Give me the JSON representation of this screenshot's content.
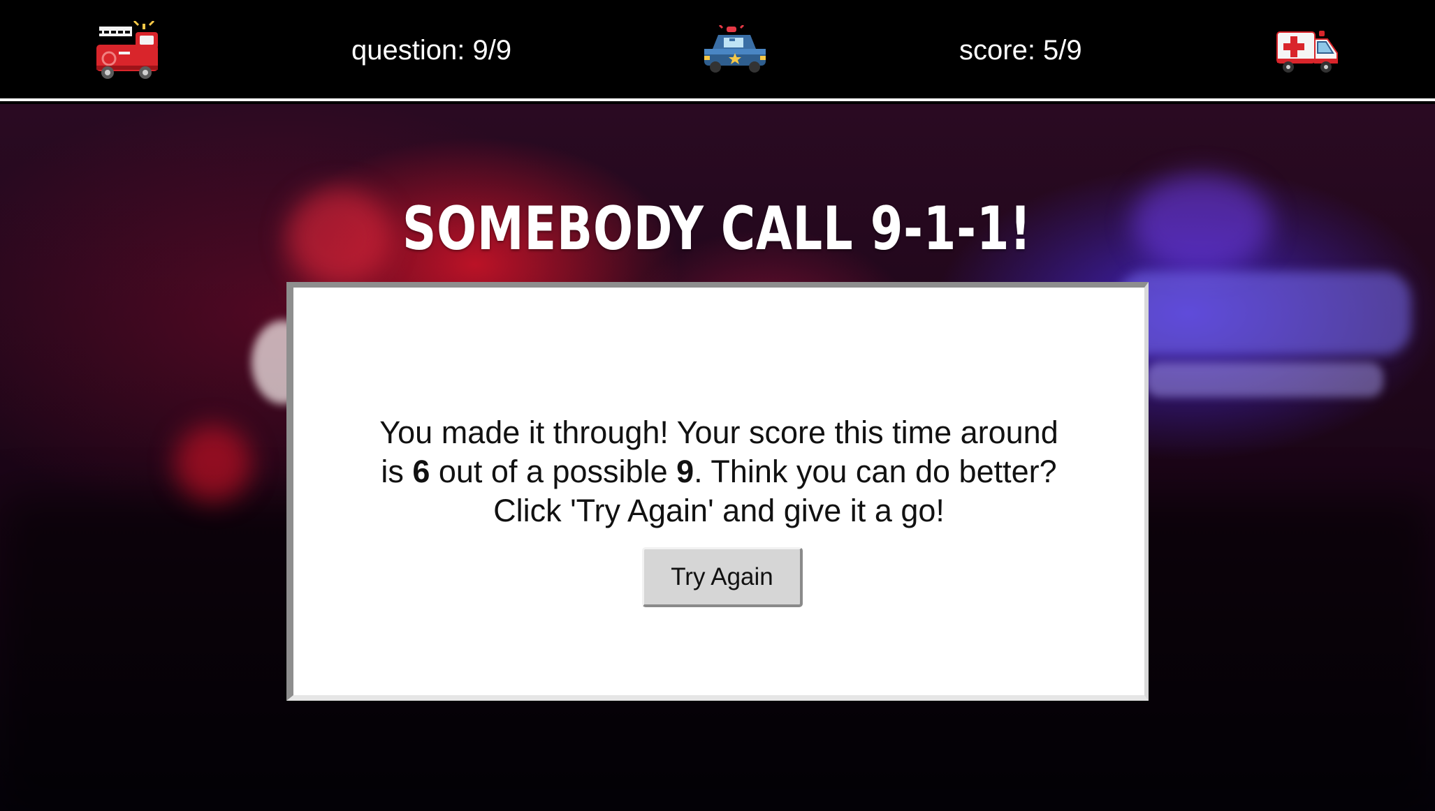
{
  "topbar": {
    "question_text": "question: 9/9",
    "score_text": "score: 5/9",
    "icons": {
      "left": "fire-truck-icon",
      "center": "police-car-icon",
      "right": "ambulance-icon"
    }
  },
  "headline": "SOMEBODY CALL 9-1-1!",
  "result": {
    "line1": "You made it through! Your score this time around",
    "line2_prefix": "is ",
    "final_score": "6",
    "line2_middle": " out of a possible ",
    "total": "9",
    "line2_suffix": ". Think you can do better?",
    "line3": "Click 'Try Again' and give it a go!",
    "button_label": "Try Again"
  },
  "colors": {
    "topbar_bg": "#000000",
    "topbar_rule": "#ffffff",
    "headline": "#ffffff",
    "card_bg": "#ffffff",
    "button_bg": "#d6d6d6"
  }
}
